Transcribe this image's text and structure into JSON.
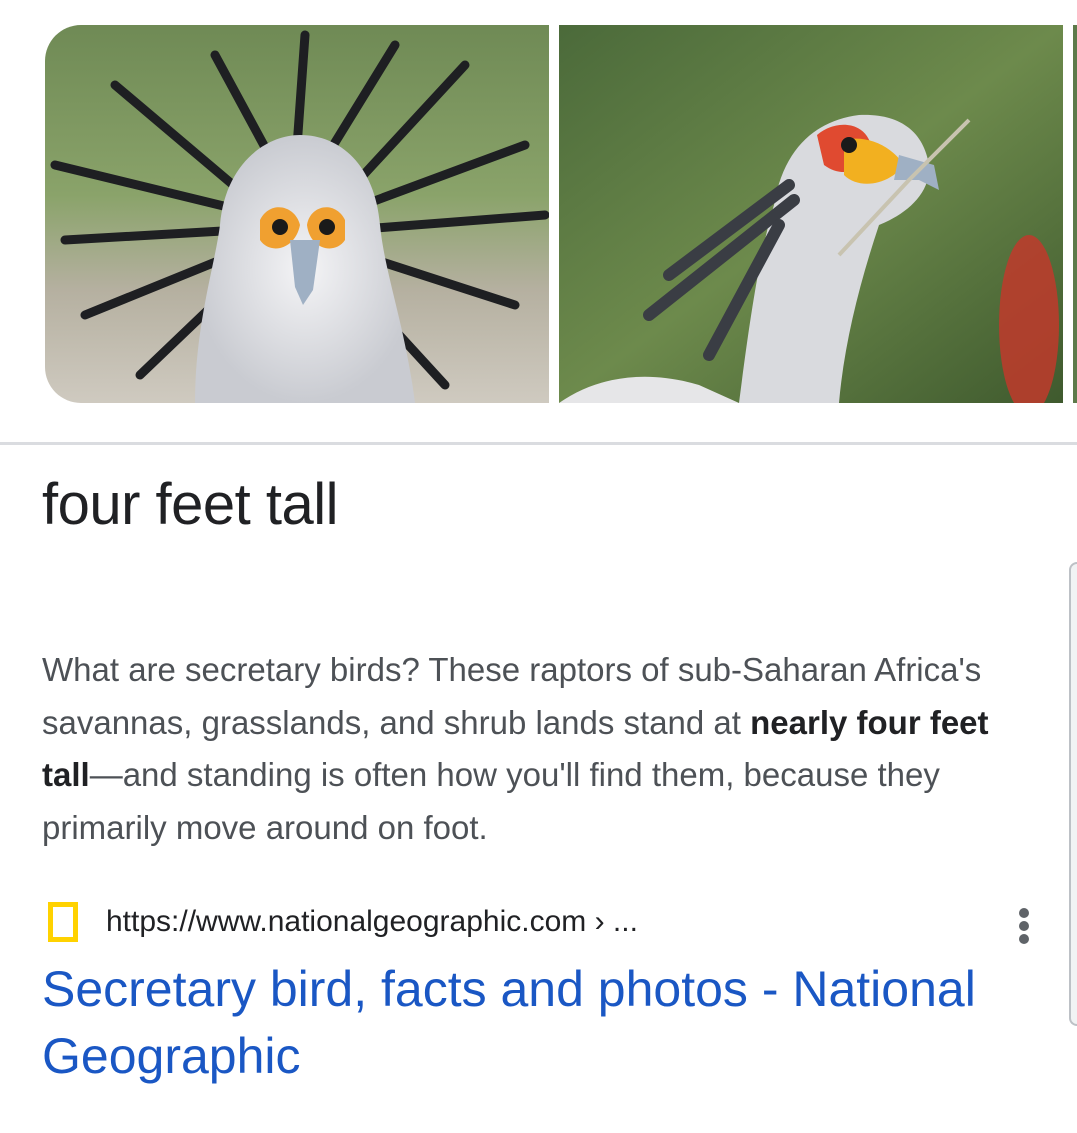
{
  "images": [
    {
      "name": "secretary-bird-front-view"
    },
    {
      "name": "secretary-bird-side-view"
    }
  ],
  "answer": {
    "text": "four feet tall"
  },
  "snippet": {
    "before": "What are secretary birds? These raptors of sub-Saharan Africa's savannas, grasslands, and shrub lands stand at ",
    "bold": "nearly four feet tall",
    "after": "—and standing is often how you'll find them, because they primarily move around on foot."
  },
  "source": {
    "url": "https://www.nationalgeographic.com › ...",
    "favicon": "nat-geo-yellow-frame-icon",
    "more_icon": "more-vert-icon"
  },
  "result": {
    "title": "Secretary bird, facts and photos - National Geographic",
    "link_color": "#1a57c4"
  },
  "colors": {
    "favicon_yellow": "#ffd200",
    "snippet_text": "#4d5156",
    "primary_text": "#202124"
  }
}
